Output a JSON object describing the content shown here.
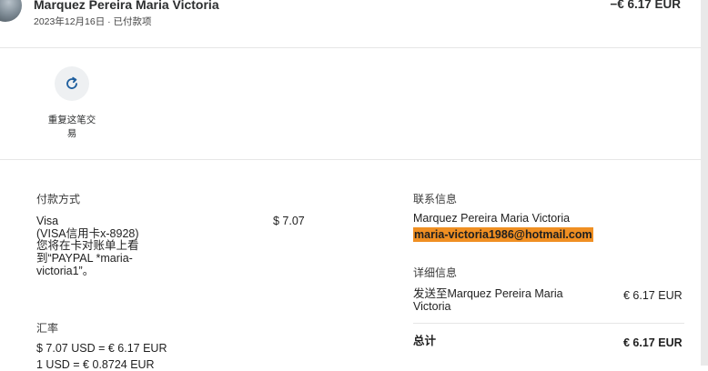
{
  "transaction": {
    "merchant": "Marquez Pereira Maria Victoria",
    "meta": "2023年12月16日 · 已付款项",
    "amount": "−€ 6.17 EUR"
  },
  "actions": {
    "repeat_label": "重复这笔交易",
    "repeat_icon": "refresh-icon"
  },
  "payment_method": {
    "heading": "付款方式",
    "card_name": "Visa",
    "card_detail": "(VISA信用卡x-8928)",
    "statement_note": "您将在卡对账单上看到“PAYPAL *maria-victoria1”。",
    "amount": "$ 7.07"
  },
  "exchange_rate": {
    "heading": "汇率",
    "line1": "$ 7.07 USD = € 6.17 EUR",
    "line2": "1 USD = € 0.8724 EUR"
  },
  "contact": {
    "heading": "联系信息",
    "name": "Marquez Pereira Maria Victoria",
    "email": "maria-victoria1986@hotmail.com",
    "highlight_color": "#f08f22"
  },
  "details": {
    "heading": "详细信息",
    "sent_to": "发送至Marquez Pereira Maria Victoria",
    "sent_amount": "€ 6.17 EUR",
    "total_label": "总计",
    "total_amount": "€ 6.17 EUR"
  }
}
